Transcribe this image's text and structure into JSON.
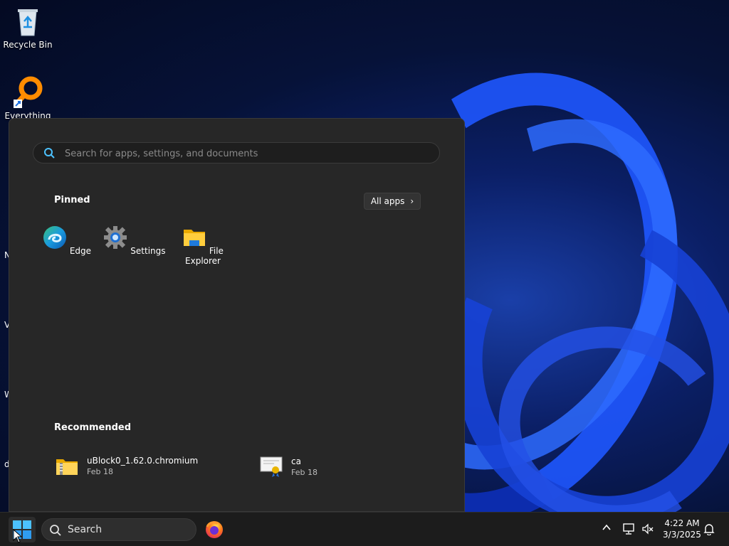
{
  "desktop": {
    "icons": [
      {
        "label": "Recycle Bin",
        "icon": "recycle-bin-icon"
      },
      {
        "label": "Everything",
        "icon": "everything-search-icon"
      }
    ],
    "edge_letters": [
      "N",
      "V",
      "W",
      "d"
    ]
  },
  "start_menu": {
    "search_placeholder": "Search for apps, settings, and documents",
    "pinned_title": "Pinned",
    "all_apps_label": "All apps",
    "pinned": [
      {
        "label": "Edge",
        "icon": "edge-icon"
      },
      {
        "label": "Settings",
        "icon": "settings-gear-icon"
      },
      {
        "label": "File Explorer",
        "icon": "folder-icon"
      }
    ],
    "recommended_title": "Recommended",
    "recommended": [
      {
        "name": "uBlock0_1.62.0.chromium",
        "date": "Feb 18",
        "icon": "zip-folder-icon"
      },
      {
        "name": "ca",
        "date": "Feb 18",
        "icon": "certificate-icon"
      }
    ]
  },
  "taskbar": {
    "search_label": "Search",
    "clock_time": "4:22 AM",
    "clock_date": "3/3/2025"
  },
  "colors": {
    "menu_bg": "#272727",
    "taskbar_bg": "#1c1c1c",
    "accent": "#0078d4"
  }
}
